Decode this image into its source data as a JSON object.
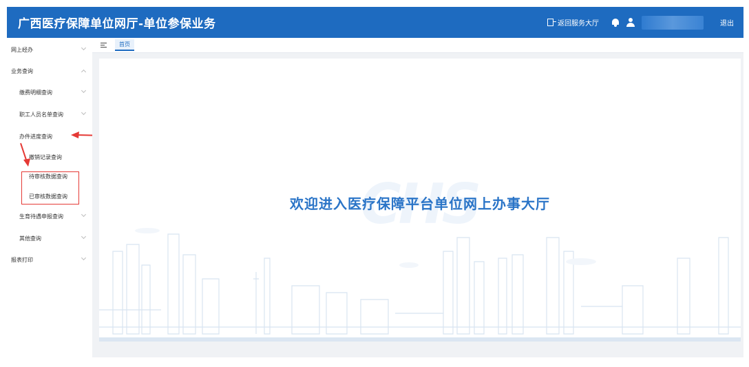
{
  "header": {
    "title": "广西医疗保障单位网厅-单位参保业务",
    "return_label": "返回服务大厅",
    "logout_label": "退出"
  },
  "sidebar": {
    "items": [
      {
        "label": "网上经办"
      },
      {
        "label": "业务查询"
      },
      {
        "label": "缴费明细查询"
      },
      {
        "label": "职工人员名单查询"
      },
      {
        "label": "办件进度查询"
      },
      {
        "label": "撤销记录查询"
      },
      {
        "label": "待审核数据查询"
      },
      {
        "label": "已审核数据查询"
      },
      {
        "label": "生育待遇申报查询"
      },
      {
        "label": "其他查询"
      },
      {
        "label": "报表打印"
      }
    ]
  },
  "tabs": [
    {
      "label": "首页"
    }
  ],
  "main": {
    "welcome_text": "欢迎进入医疗保障平台单位网上办事大厅",
    "watermark": "CHS"
  },
  "colors": {
    "brand": "#1e6bc0",
    "annotation": "#e53935",
    "welcome_text": "#2a74c7"
  }
}
